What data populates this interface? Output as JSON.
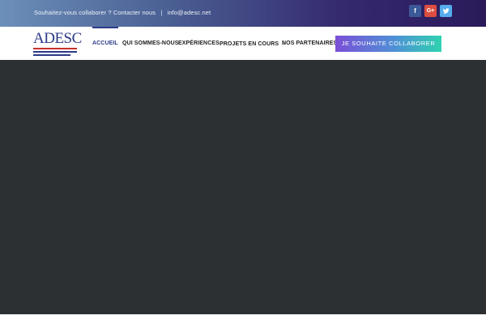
{
  "topbar": {
    "text_collab": "Souhaitez-vous collaborer ? Contacter nous",
    "separator": "|",
    "email": "info@adesc.net",
    "social": [
      {
        "icon": "facebook-icon",
        "glyph": "f",
        "color": "#3b5998"
      },
      {
        "icon": "google-plus-icon",
        "glyph": "G+",
        "color": "#dc4e41"
      },
      {
        "icon": "twitter-icon",
        "glyph": "🐦",
        "color": "#55acee"
      }
    ]
  },
  "header": {
    "logo_text": "ADESC",
    "nav": [
      {
        "label": "ACCUEIL",
        "active": true
      },
      {
        "label": "QUI SOMMES-NOUS"
      },
      {
        "label": "EXPÉRIENCES"
      },
      {
        "label": "PROJETS EN COURS",
        "has_dropdown": true
      },
      {
        "label": "NOS PARTENAIRES"
      }
    ],
    "cta_label": "JE SOUHAITE COLLABORER"
  },
  "colors": {
    "brand_blue": "#2d3a88",
    "hero_bg": "#2d3033",
    "cta_gradient_start": "#7b4fd6",
    "cta_gradient_end": "#2fd2b0"
  }
}
